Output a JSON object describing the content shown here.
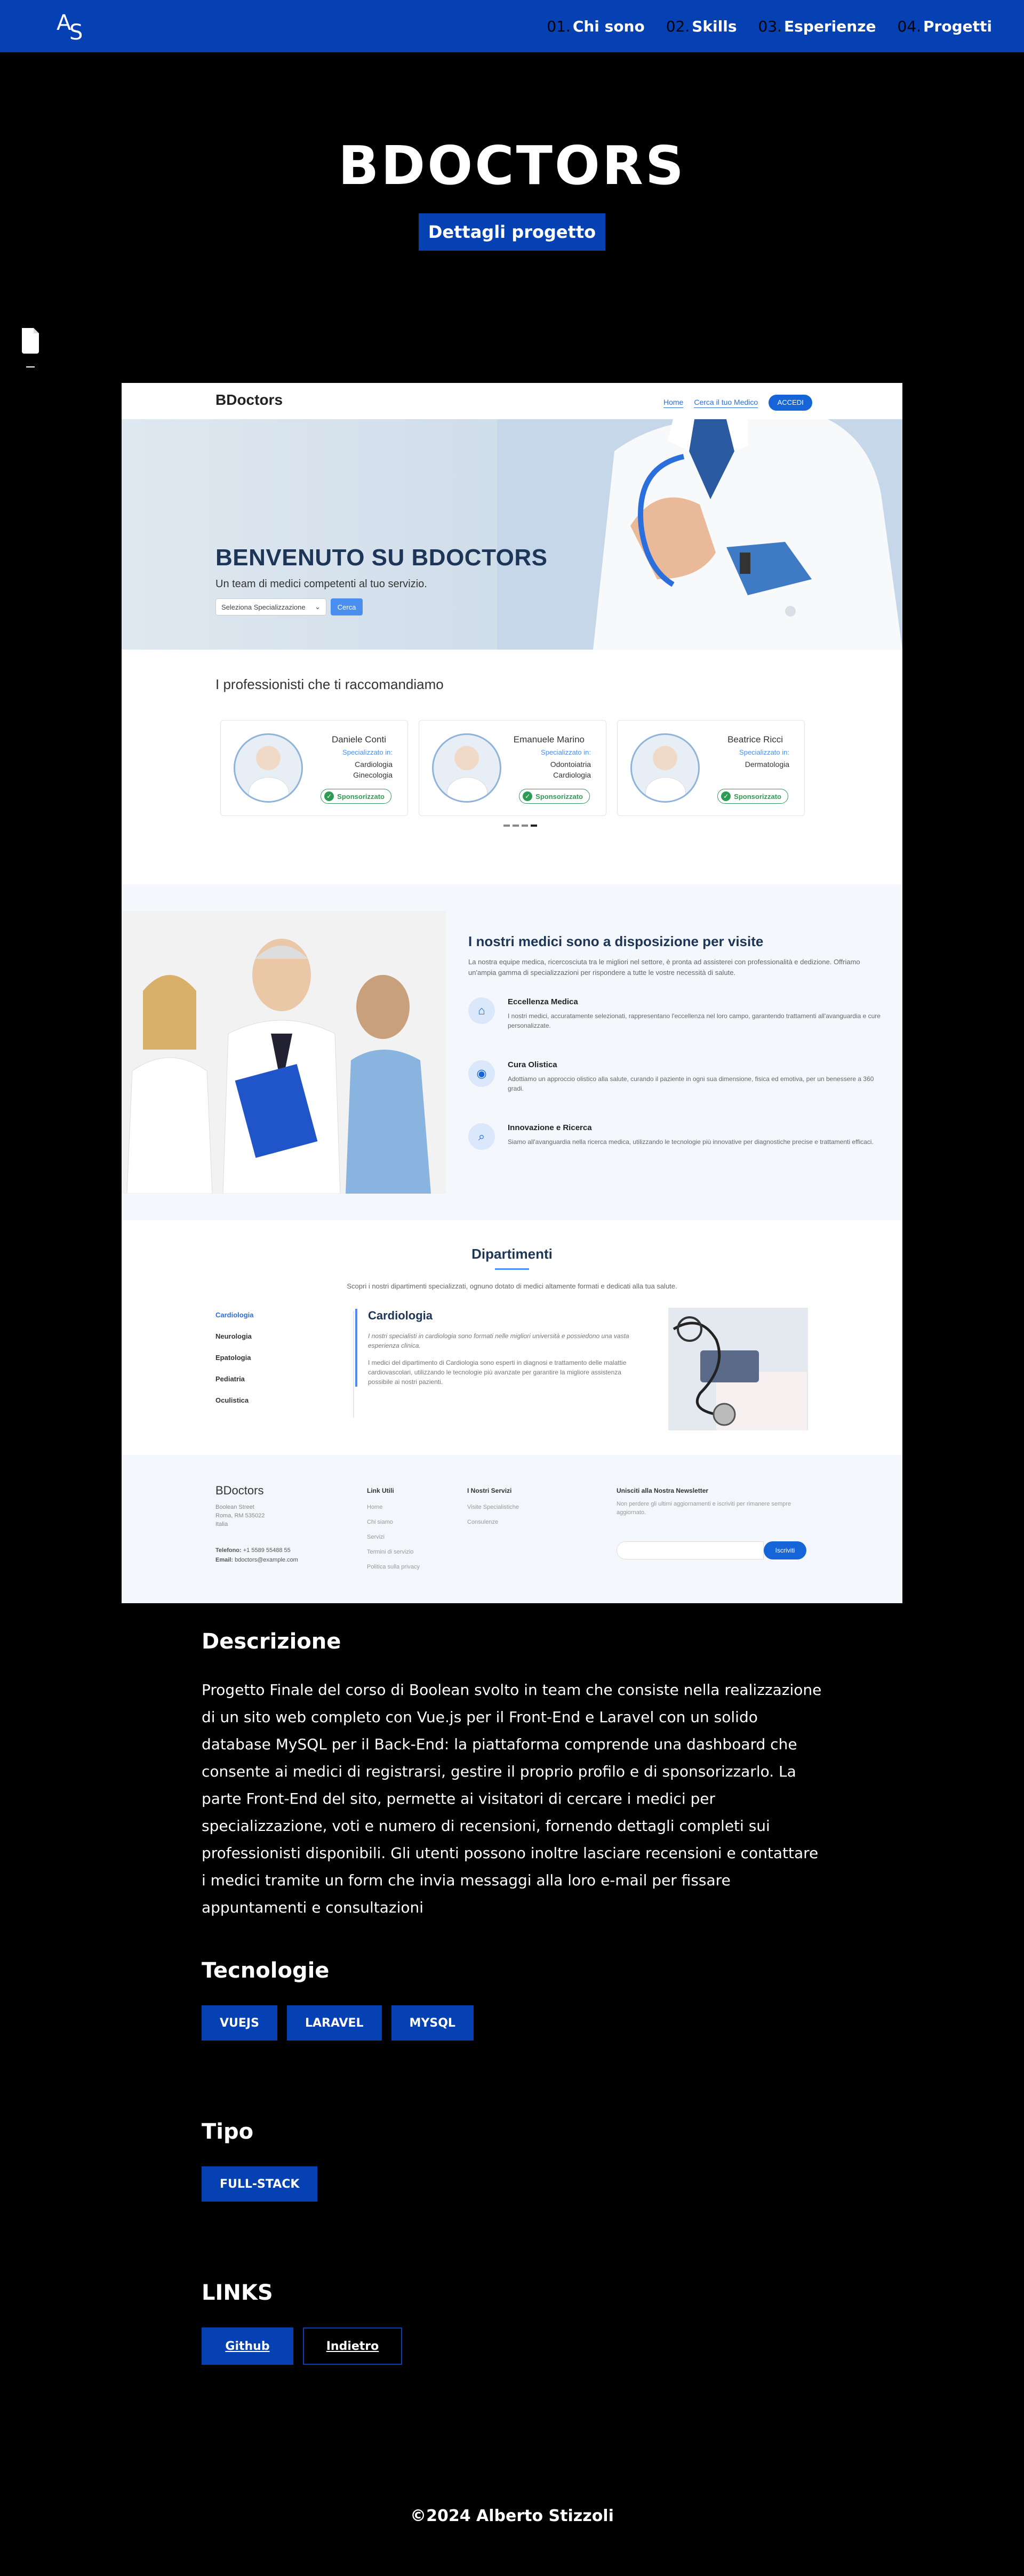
{
  "navbar": {
    "logo_top": "A",
    "logo_bottom": "S",
    "links": [
      {
        "num": "01.",
        "label": "Chi sono"
      },
      {
        "num": "02.",
        "label": "Skills"
      },
      {
        "num": "03.",
        "label": "Esperienze"
      },
      {
        "num": "04.",
        "label": "Progetti"
      }
    ]
  },
  "project": {
    "title": "BDOCTORS",
    "detail_button": "Dettagli progetto"
  },
  "screenshot": {
    "brand": "BDoctors",
    "nav": [
      "Home",
      "Cerca il tuo Medico",
      "ACCEDI"
    ],
    "hero_title": "BENVENUTO SU BDOCTORS",
    "hero_subtitle": "Un team di medici competenti al tuo servizio.",
    "select_placeholder": "Seleziona Specializzazione",
    "search_button": "Cerca",
    "recommend_title": "I professionisti che ti raccomandiamo",
    "doctors": [
      {
        "name": "Daniele Conti",
        "label": "Specializzato in:",
        "specs": [
          "Cardiologia",
          "Ginecologia"
        ],
        "badge": "Sponsorizzato"
      },
      {
        "name": "Emanuele Marino",
        "label": "Specializzato in:",
        "specs": [
          "Odontoiatria",
          "Cardiologia"
        ],
        "badge": "Sponsorizzato"
      },
      {
        "name": "Beatrice Ricci",
        "label": "Specializzato in:",
        "specs": [
          "Dermatologia"
        ],
        "badge": "Sponsorizzato"
      }
    ],
    "docs_title": "I nostri medici sono a disposizione per visite",
    "docs_intro": "La nostra equipe medica, ricercosciuta tra le migliori nel settore, è pronta ad assisterei con professionalità e dedizione. Offriamo un'ampia gamma di specializzazioni per rispondere a tutte le vostre necessità di salute.",
    "features": [
      {
        "title": "Eccellenza Medica",
        "text": "I nostri medici, accuratamente selezionati, rappresentano l'eccellenza nel loro campo, garantendo trattamenti all'avanguardia e cure personalizzate."
      },
      {
        "title": "Cura Olistica",
        "text": "Adottiamo un approccio olistico alla salute, curando il paziente in ogni sua dimensione, fisica ed emotiva, per un benessere a 360 gradi."
      },
      {
        "title": "Innovazione e Ricerca",
        "text": "Siamo all'avanguardia nella ricerca medica, utilizzando le tecnologie più innovative per diagnostiche precise e trattamenti efficaci."
      }
    ],
    "dept_title": "Dipartimenti",
    "dept_subtitle": "Scopri i nostri dipartimenti specializzati, ognuno dotato di medici altamente formati e dedicati alla tua salute.",
    "departments": [
      "Cardiologia",
      "Neurologia",
      "Epatologia",
      "Pediatria",
      "Oculistica"
    ],
    "dept_active_title": "Cardiologia",
    "dept_active_italic": "I nostri specialisti in cardiologia sono formati nelle migliori università e possiedono una vasta esperienza clinica.",
    "dept_active_text": "I medici del dipartimento di Cardiologia sono esperti in diagnosi e trattamento delle malattie cardiovascolari, utilizzando le tecnologie più avanzate per garantire la migliore assistenza possibile ai nostri pazienti.",
    "footer": {
      "brand": "BDoctors",
      "address": [
        "Boolean Street",
        "Roma, RM 535022",
        "Italia"
      ],
      "phone_label": "Telefono:",
      "phone": "+1 5589 55488 55",
      "email_label": "Email:",
      "email": "bdoctors@example.com",
      "links_title": "Link Utili",
      "links": [
        "Home",
        "Chi siamo",
        "Servizi",
        "Termini di servizio",
        "Politica sulla privacy"
      ],
      "services_title": "I Nostri Servizi",
      "services": [
        "Visite Specialistiche",
        "Consulenze"
      ],
      "newsletter_title": "Unisciti alla Nostra Newsletter",
      "newsletter_text": "Non perdere gli ultimi aggiornamenti e iscriviti per rimanere sempre aggiornato.",
      "newsletter_button": "Iscriviti"
    }
  },
  "description": {
    "title": "Descrizione",
    "text": "Progetto Finale del corso di Boolean svolto in team che consiste nella realizzazione di un sito web completo con Vue.js per il Front-End e Laravel con un solido database MySQL per il Back-End: la piattaforma comprende una dashboard che consente ai medici di registrarsi, gestire il proprio profilo e di sponsorizzarlo. La parte Front-End del sito, permette ai visitatori di cercare i medici per specializzazione, voti e numero di recensioni, fornendo dettagli completi sui professionisti disponibili. Gli utenti possono inoltre lasciare recensioni e contattare i medici tramite un form che invia messaggi alla loro e-mail per fissare appuntamenti e consultazioni"
  },
  "technologies": {
    "title": "Tecnologie",
    "items": [
      "VUEJS",
      "LARAVEL",
      "MYSQL"
    ]
  },
  "type": {
    "title": "Tipo",
    "items": [
      "FULL-STACK"
    ]
  },
  "links": {
    "title": "LINKS",
    "github": "Github",
    "back": "Indietro"
  },
  "footer": {
    "copyright": "©2024 Alberto Stizzoli"
  },
  "colors": {
    "accent": "#0641b3",
    "background": "#000000"
  }
}
